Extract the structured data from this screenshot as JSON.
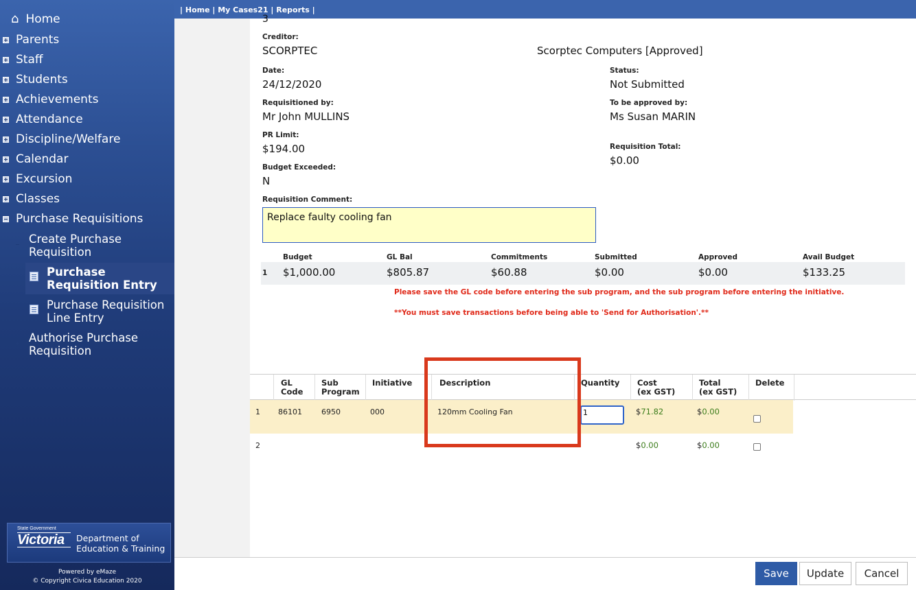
{
  "topbar": {
    "home": "Home",
    "cases": "My Cases21",
    "reports": "Reports"
  },
  "sidebar": {
    "home": "Home",
    "items": [
      "Parents",
      "Staff",
      "Students",
      "Achievements",
      "Attendance",
      "Discipline/Welfare",
      "Calendar",
      "Excursion",
      "Classes",
      "Purchase Requisitions"
    ],
    "create_pr": "Create Purchase Requisition",
    "pr_entry": "Purchase Requisition Entry",
    "pr_line_entry": "Purchase Requisition Line Entry",
    "authorise_pr": "Authorise Purchase Requisition",
    "logo_small": "State Government",
    "logo_big": "Victoria",
    "dept_line1": "Department of",
    "dept_line2": "Education & Training",
    "powered_by": "Powered by eMaze",
    "copyright": "© Copyright Civica Education 2020"
  },
  "form": {
    "top_cut": "3",
    "creditor_label": "Creditor:",
    "creditor_code": "SCORPTEC",
    "creditor_name": "Scorptec Computers [Approved]",
    "date_label": "Date:",
    "date": "24/12/2020",
    "status_label": "Status:",
    "status": "Not Submitted",
    "requisitioned_label": "Requisitioned by:",
    "requisitioned_by": "Mr John MULLINS",
    "approver_label": "To be approved by:",
    "approver": "Ms Susan MARIN",
    "pr_limit_label": "PR Limit:",
    "pr_limit": "$194.00",
    "total_label": "Requisition Total:",
    "total": "$0.00",
    "exceeded_label": "Budget Exceeded:",
    "exceeded": "N",
    "comment_label": "Requisition Comment:",
    "comment": "Replace faulty cooling fan"
  },
  "budget": {
    "headers": [
      "Budget",
      "GL Bal",
      "Commitments",
      "Submitted",
      "Approved",
      "Avail Budget"
    ],
    "row_num": "1",
    "values": [
      "$1,000.00",
      "$805.87",
      "$60.88",
      "$0.00",
      "$0.00",
      "$133.25"
    ]
  },
  "notices": {
    "n1": "Please save the GL code before entering the sub program, and the sub program before entering the initiative.",
    "n2": "**You must save transactions before being able to 'Send for Authorisation'.**"
  },
  "grid": {
    "headers": {
      "gl1": "GL",
      "gl2": "Code",
      "sub1": "Sub",
      "sub2": "Program",
      "initiative": "Initiative",
      "description": "Description",
      "quantity": "Quantity",
      "cost1": "Cost",
      "cost2": "(ex GST)",
      "total1": "Total",
      "total2": "(ex GST)",
      "delete": "Delete"
    },
    "rows": [
      {
        "num": "1",
        "gl": "86101",
        "sub": "6950",
        "initiative": "000",
        "description": "120mm Cooling Fan",
        "quantity": "1",
        "cost": "71.82",
        "total": "0.00"
      },
      {
        "num": "2",
        "cost": "0.00",
        "total": "0.00"
      }
    ],
    "currency": "$"
  },
  "buttons": {
    "save": "Save",
    "update": "Update",
    "cancel": "Cancel"
  },
  "colors": {
    "sidebar": "#2c4f93",
    "topbar": "#3b64ad",
    "highlight": "#d9391c",
    "notice": "#e02a1a",
    "row_hl": "#fbefc9"
  }
}
